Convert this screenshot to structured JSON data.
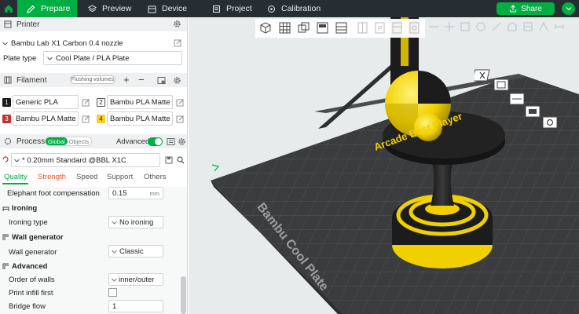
{
  "topbar": {
    "tabs": [
      "Prepare",
      "Preview",
      "Device",
      "Project",
      "Calibration"
    ],
    "share_label": "Share"
  },
  "printer": {
    "title": "Printer",
    "selected": "Bambu Lab X1 Carbon 0.4 nozzle",
    "plate_type_label": "Plate type",
    "plate_type_value": "Cool Plate / PLA Plate"
  },
  "filament": {
    "title": "Filament",
    "flush_label": "Flushing volumes",
    "slots": [
      {
        "num": "1",
        "name": "Generic PLA",
        "color": "#1a1a1a"
      },
      {
        "num": "2",
        "name": "Bambu PLA Matte",
        "color": "#ffffff"
      },
      {
        "num": "3",
        "name": "Bambu PLA Matte",
        "color": "#c0342f"
      },
      {
        "num": "4",
        "name": "Bambu PLA Matte",
        "color": "#f4d02a"
      }
    ]
  },
  "process": {
    "title": "Process",
    "global_label": "Global",
    "objects_label": "Objects",
    "advanced_label": "Advanced",
    "profile": "* 0.20mm Standard @BBL X1C",
    "tabs": [
      "Quality",
      "Strength",
      "Speed",
      "Support",
      "Others"
    ]
  },
  "settings": {
    "elephant_foot_label": "Elephant foot compensation",
    "elephant_foot_value": "0.15",
    "elephant_foot_unit": "mm",
    "ironing_group": "Ironing",
    "ironing_type_label": "Ironing type",
    "ironing_type_value": "No ironing",
    "wall_generator_group": "Wall generator",
    "wall_generator_label": "Wall generator",
    "wall_generator_value": "Classic",
    "advanced_group": "Advanced",
    "order_of_walls_label": "Order of walls",
    "order_of_walls_value": "inner/outer",
    "print_infill_first_label": "Print infill first",
    "bridge_flow_label": "Bridge flow",
    "bridge_flow_value": "1"
  },
  "viewport": {
    "bed_text": "Bambu Cool Plate",
    "model_text": "Arcade Best Player"
  },
  "colors": {
    "accent": "#00ae42",
    "topbar": "#262e33",
    "model_yellow": "#f1d000",
    "model_black": "#1c1c1c"
  }
}
